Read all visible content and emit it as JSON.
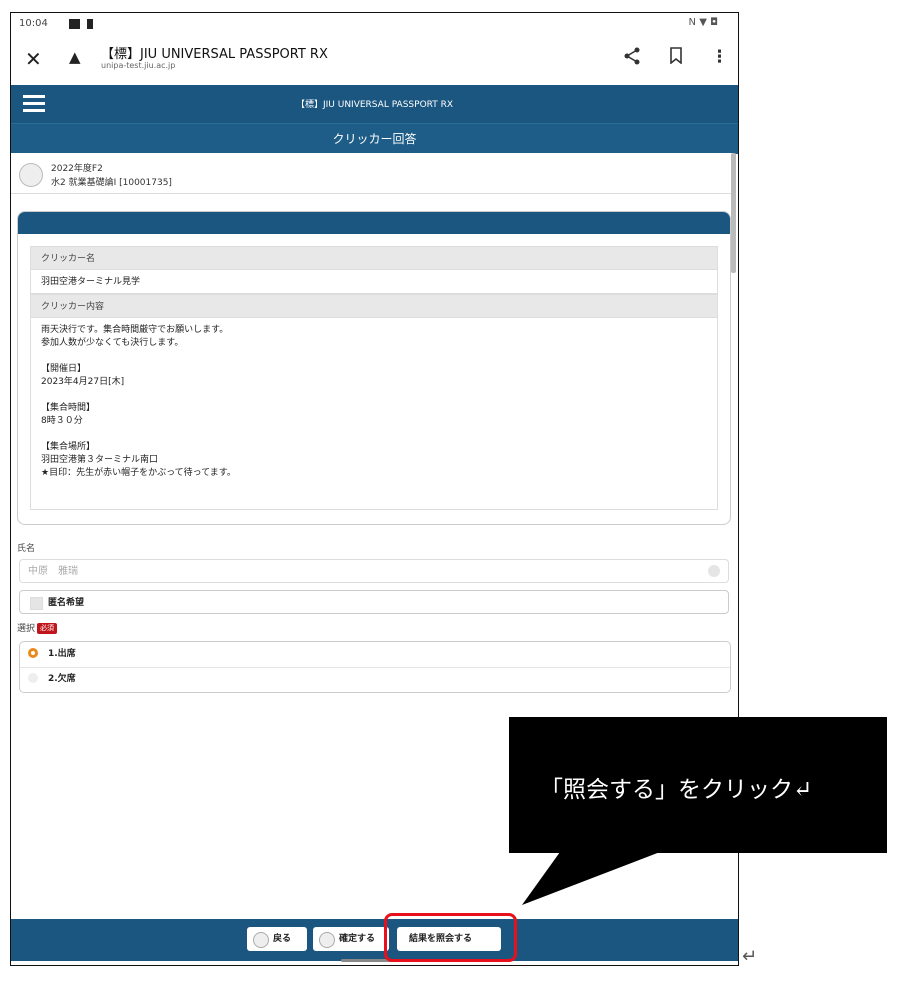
{
  "status": {
    "time": "10:04",
    "icons": "N ▼ ◘"
  },
  "browser": {
    "title": "【標】JIU UNIVERSAL PASSPORT RX",
    "url": "unipa-test.jiu.ac.jp",
    "close_icon": "close-icon",
    "share_icon": "share-icon",
    "bookmark_icon": "bookmark-icon",
    "more_icon": "more-icon"
  },
  "app": {
    "title": "【標】JIU UNIVERSAL PASSPORT RX",
    "page_title": "クリッカー回答"
  },
  "course": {
    "term": "2022年度F2",
    "name": "水2 就業基礎論Ⅰ [10001735]"
  },
  "clicker": {
    "name_label": "クリッカー名",
    "name_value": "羽田空港ターミナル見学",
    "content_label": "クリッカー内容",
    "content_lines": [
      "雨天決行です。集合時間厳守でお願いします。",
      "参加人数が少なくても決行します。",
      "",
      "【開催日】",
      "  2023年4月27日[木]",
      "",
      "【集合時間】",
      "  8時３０分",
      "",
      "【集合場所】",
      "羽田空港第３ターミナル南口",
      "★目印：先生が赤い帽子をかぶって待ってます。"
    ]
  },
  "form": {
    "name_label": "氏名",
    "name_placeholder": "中原　雅瑞",
    "anonymous_label": "匿名希望",
    "choice_label": "選択",
    "required_badge": "必須",
    "options": [
      {
        "label": "1.出席",
        "selected": true
      },
      {
        "label": "2.欠席",
        "selected": false
      }
    ]
  },
  "footer": {
    "back": "戻る",
    "confirm": "確定する",
    "view_results": "結果を照会する"
  },
  "annotation": {
    "callout": "「照会する」をクリック↵",
    "return_mark": "↵"
  },
  "colors": {
    "header": "#1a567f",
    "highlight": "#e8111b",
    "radio": "#e98a1a"
  }
}
